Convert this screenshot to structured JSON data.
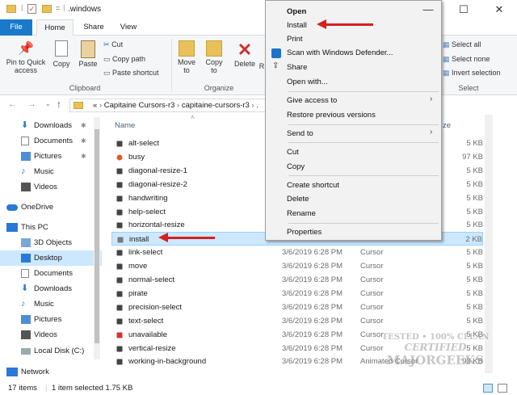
{
  "window": {
    "title": ".windows",
    "controls": [
      "minimize-icon",
      "maximize-icon",
      "close-icon"
    ]
  },
  "tabs": [
    {
      "label": "File"
    },
    {
      "label": "Home"
    },
    {
      "label": "Share"
    },
    {
      "label": "View"
    }
  ],
  "ribbon": {
    "clipboard": {
      "pin_to_quick_access": "Pin to Quick access",
      "copy": "Copy",
      "paste": "Paste",
      "cut": "Cut",
      "copy_path": "Copy path",
      "paste_shortcut": "Paste shortcut",
      "group_label": "Clipboard"
    },
    "organize": {
      "move_to": "Move to",
      "copy_to": "Copy to",
      "delete": "Delete",
      "rename_partial": "R",
      "group_label": "Organize"
    },
    "select": {
      "select_all": "Select all",
      "select_none": "Select none",
      "invert_selection": "Invert selection",
      "group_label": "Select"
    }
  },
  "address": {
    "prefix": "«",
    "crumbs": [
      "Capitaine Cursors-r3",
      "capitaine-cursors-r3",
      "."
    ]
  },
  "nav": {
    "quick": [
      {
        "label": "Downloads",
        "icon": "download-icon",
        "pinned": true
      },
      {
        "label": "Documents",
        "icon": "documents-icon",
        "pinned": true
      },
      {
        "label": "Pictures",
        "icon": "pictures-icon",
        "pinned": true
      },
      {
        "label": "Music",
        "icon": "music-icon",
        "pinned": false
      },
      {
        "label": "Videos",
        "icon": "videos-icon",
        "pinned": false
      }
    ],
    "onedrive": "OneDrive",
    "thispc": "This PC",
    "pc_items": [
      {
        "label": "3D Objects",
        "icon": "3d-objects-icon"
      },
      {
        "label": "Desktop",
        "icon": "desktop-icon",
        "selected": true
      },
      {
        "label": "Documents",
        "icon": "documents-icon"
      },
      {
        "label": "Downloads",
        "icon": "download-icon"
      },
      {
        "label": "Music",
        "icon": "music-icon"
      },
      {
        "label": "Pictures",
        "icon": "pictures-icon"
      },
      {
        "label": "Videos",
        "icon": "videos-icon"
      },
      {
        "label": "Local Disk (C:)",
        "icon": "drive-icon"
      }
    ],
    "network": "Network"
  },
  "columns": {
    "name": "Name",
    "size_partial": "ze"
  },
  "files": [
    {
      "name": "alt-select",
      "date": "",
      "type": "",
      "size": "5 KB"
    },
    {
      "name": "busy",
      "date": "",
      "type": "",
      "size": "97 KB"
    },
    {
      "name": "diagonal-resize-1",
      "date": "",
      "type": "",
      "size": "5 KB"
    },
    {
      "name": "diagonal-resize-2",
      "date": "",
      "type": "",
      "size": "5 KB"
    },
    {
      "name": "handwriting",
      "date": "",
      "type": "",
      "size": "5 KB"
    },
    {
      "name": "help-select",
      "date": "",
      "type": "",
      "size": "5 KB"
    },
    {
      "name": "horizontal-resize",
      "date": "",
      "type": "",
      "size": "5 KB"
    },
    {
      "name": "install",
      "date": "",
      "type": "",
      "size": "2 KB"
    },
    {
      "name": "link-select",
      "date": "3/6/2019 6:28 PM",
      "type": "Cursor",
      "size": "5 KB"
    },
    {
      "name": "move",
      "date": "3/6/2019 6:28 PM",
      "type": "Cursor",
      "size": "5 KB"
    },
    {
      "name": "normal-select",
      "date": "3/6/2019 6:28 PM",
      "type": "Cursor",
      "size": "5 KB"
    },
    {
      "name": "pirate",
      "date": "3/6/2019 6:28 PM",
      "type": "Cursor",
      "size": "5 KB"
    },
    {
      "name": "precision-select",
      "date": "3/6/2019 6:28 PM",
      "type": "Cursor",
      "size": "5 KB"
    },
    {
      "name": "text-select",
      "date": "3/6/2019 6:28 PM",
      "type": "Cursor",
      "size": "5 KB"
    },
    {
      "name": "unavailable",
      "date": "3/6/2019 6:28 PM",
      "type": "Cursor",
      "size": "5 KB"
    },
    {
      "name": "vertical-resize",
      "date": "3/6/2019 6:28 PM",
      "type": "Cursor",
      "size": "5 KB"
    },
    {
      "name": "working-in-background",
      "date": "3/6/2019 6:28 PM",
      "type": "Animated Cursor",
      "size": "93 KB"
    }
  ],
  "context_menu": {
    "open": "Open",
    "install": "Install",
    "print": "Print",
    "scan": "Scan with Windows Defender...",
    "share": "Share",
    "open_with": "Open with...",
    "give_access": "Give access to",
    "restore": "Restore previous versions",
    "send_to": "Send to",
    "cut": "Cut",
    "copy": "Copy",
    "create_shortcut": "Create shortcut",
    "delete": "Delete",
    "rename": "Rename",
    "properties": "Properties"
  },
  "status": {
    "count": "17 items",
    "selected": "1 item selected  1.75 KB"
  },
  "watermark": {
    "line1": "TESTED • 100% CLEAN",
    "line2": "CERTIFIED",
    "line3": "MAJORGEEKS",
    ".com": ".COM"
  },
  "colors": {
    "accent": "#1979ca",
    "selection": "#cce8ff",
    "arrow": "#d62020"
  }
}
